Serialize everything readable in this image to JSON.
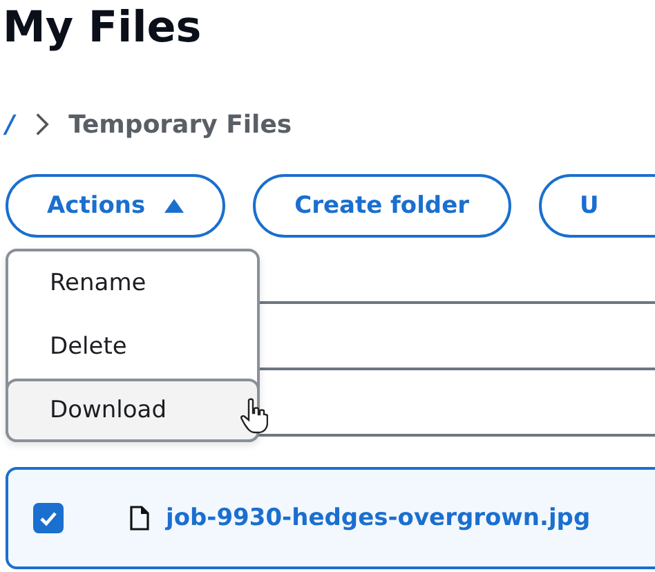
{
  "page": {
    "title": "My Files"
  },
  "breadcrumb": [
    {
      "label": "/"
    },
    {
      "label": "Temporary Files"
    }
  ],
  "toolbar": [
    {
      "label": "Actions",
      "kind": "dropdown",
      "expanded": true
    },
    {
      "label": "Create folder",
      "kind": "button"
    },
    {
      "label": "U",
      "kind": "button"
    }
  ],
  "menu": [
    {
      "label": "Rename",
      "selected": false
    },
    {
      "label": "Delete",
      "selected": false
    },
    {
      "label": "Download",
      "selected": true
    }
  ],
  "files": [
    {
      "name": "job-9930-hedges-overgrown.jpg",
      "checked": true
    }
  ]
}
